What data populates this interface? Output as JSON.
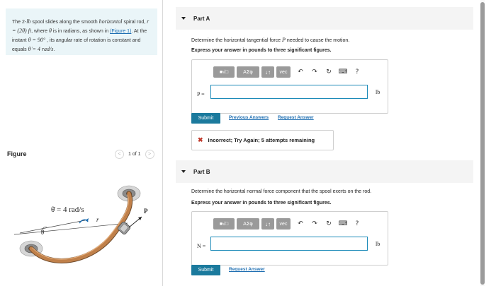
{
  "problem": {
    "seg1": "The 2-",
    "unit_lb": "lb",
    "seg2": " spool slides along the smooth ",
    "horizontal": "horizontal",
    "seg3": " spiral rod, ",
    "eq": "r = (2θ) ft",
    "seg4": ", where ",
    "theta": "θ",
    "seg5": " is in radians, as shown in ",
    "figure_link": "(Figure 1)",
    "seg6": ". At the instant ",
    "angle": "θ = 90°",
    "seg7": " , its angular rate of rotation is constant and equals ",
    "rate": "θ̇ = 4 rad/s",
    "seg8": "."
  },
  "figure": {
    "title": "Figure",
    "pager": "1 of 1",
    "prev": "<",
    "next": ">",
    "rate_label": "θ̇ = 4 rad/s",
    "r_label": "r",
    "theta_label": "θ",
    "p_label": "P"
  },
  "partA": {
    "title": "Part A",
    "question_pre": "Determine the horizontal tangential force ",
    "question_var": "P",
    "question_post": " needed to cause the motion.",
    "instruction": "Express your answer in pounds to three significant figures.",
    "var_label": "P =",
    "unit": "lb",
    "input_value": "",
    "submit": "Submit",
    "prev_answers": "Previous Answers",
    "request_answer": "Request Answer",
    "feedback": "Incorrect; Try Again; 5 attempts remaining",
    "feedback_icon": "✖"
  },
  "partB": {
    "title": "Part B",
    "question": "Determine the horizontal normal force component that the spool exerts on the rod.",
    "instruction": "Express your answer in pounds to three significant figures.",
    "var_label": "N =",
    "unit": "lb",
    "input_value": "",
    "submit": "Submit",
    "request_answer": "Request Answer"
  },
  "toolbar": {
    "template_icon": "■√□",
    "symbols": "ΑΣφ",
    "arrows": "↓↑",
    "vec": "vec",
    "undo": "↶",
    "redo": "↷",
    "reset": "↻",
    "keyboard": "⌨",
    "help": "?"
  },
  "colors": {
    "accent": "#1b7a9d",
    "link": "#1f6fb2",
    "error": "#c0392b",
    "rod": "#c0804a",
    "panel": "#eaf5f8"
  },
  "icons": {
    "collapse": "triangle-down-icon",
    "undo": "undo-icon",
    "redo": "redo-icon",
    "reset": "reset-icon",
    "keyboard": "keyboard-icon",
    "help": "help-icon",
    "error": "x-icon"
  }
}
